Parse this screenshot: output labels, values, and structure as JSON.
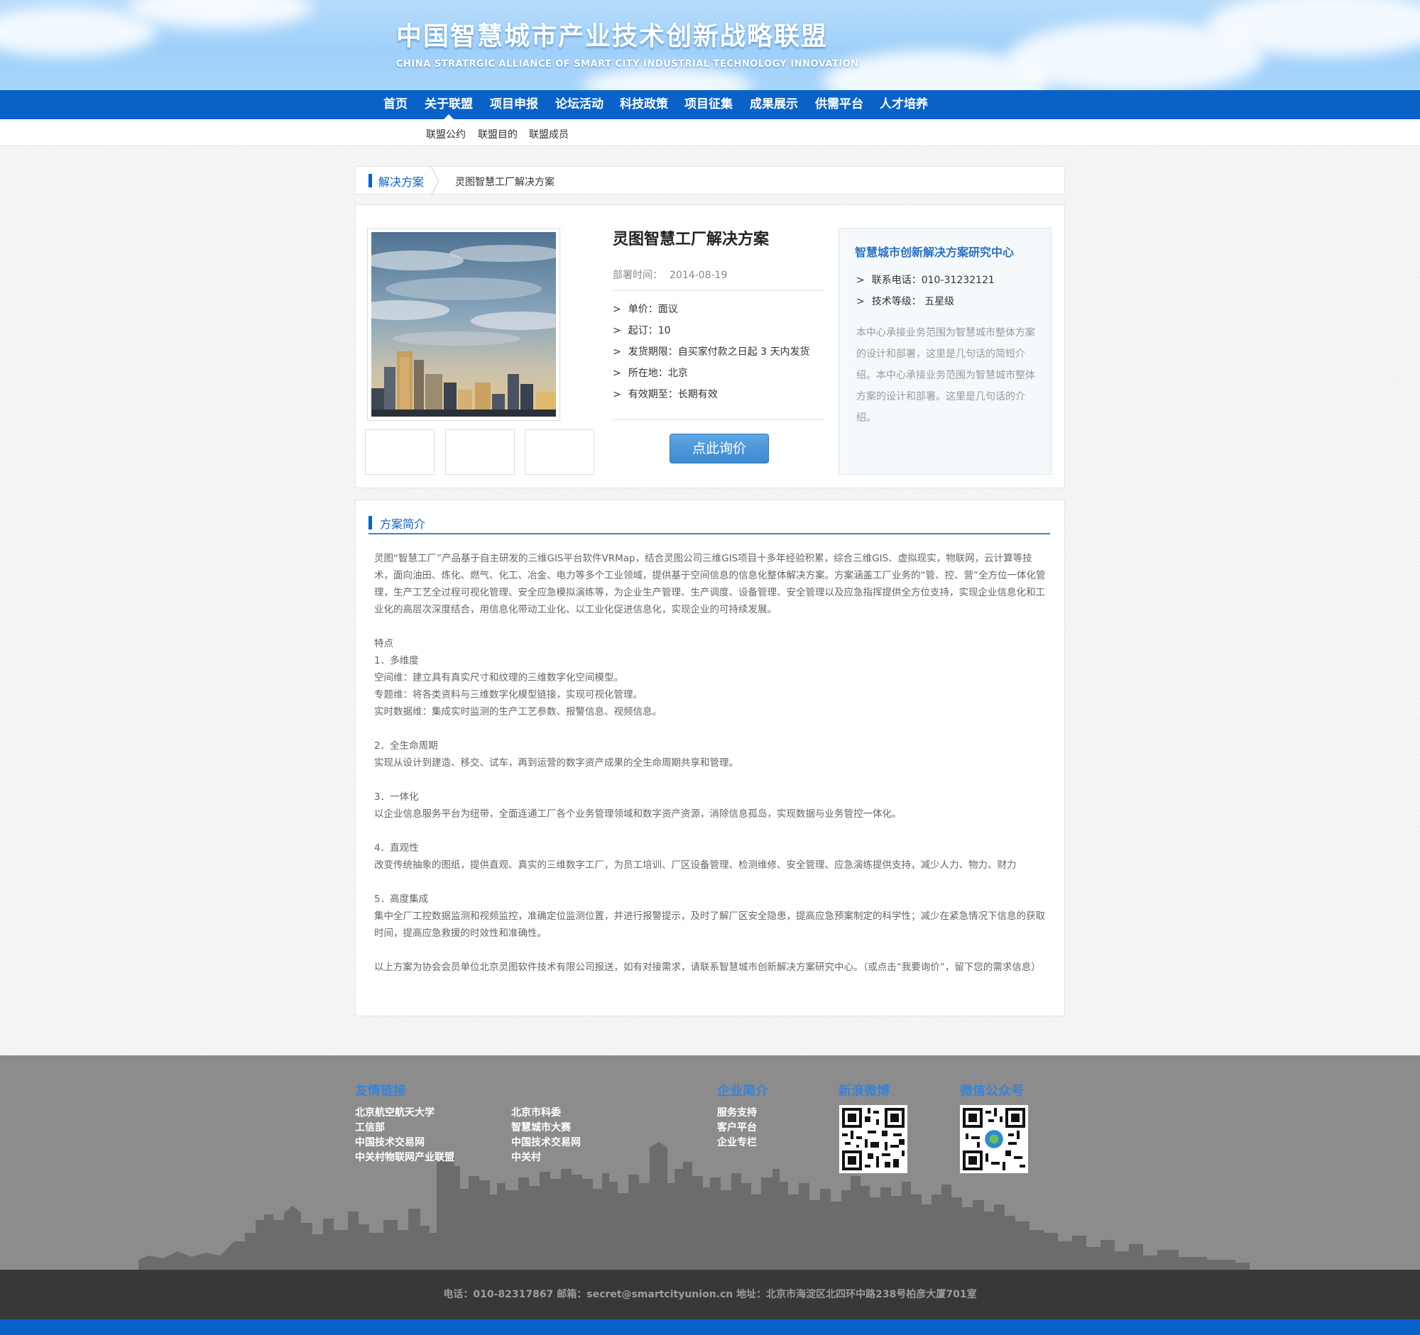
{
  "header": {
    "title": "中国智慧城市产业技术创新战略联盟",
    "subtitle": "CHINA STRATRGIC ALLIANCE OF SMART CITY INDUSTRIAL TECHNOLOGY INNOVATION"
  },
  "nav": {
    "items": [
      "首页",
      "关于联盟",
      "项目申报",
      "论坛活动",
      "科技政策",
      "项目征集",
      "成果展示",
      "供需平台",
      "人才培养"
    ],
    "active": "关于联盟",
    "subitems": [
      "联盟公约",
      "联盟目的",
      "联盟成员"
    ]
  },
  "breadcrumb": {
    "section": "解决方案",
    "current": "灵图智慧工厂解决方案"
  },
  "product": {
    "title": "灵图智慧工厂解决方案",
    "date_label": "部署时间：",
    "date": "2014-08-19",
    "specs": [
      "单价：面议",
      "起订：10",
      "发货期限：自买家付款之日起 3 天内发货",
      "所在地：北京",
      "有效期至：长期有效"
    ],
    "inquiry_button": "点此询价",
    "bullet": ">"
  },
  "center": {
    "title": "智慧城市创新解决方案研究中心",
    "phone": "联系电话：010-31232121",
    "level": "技术等级： 五星级",
    "description": "本中心承接业务范围为智慧城市整体方案的设计和部署，这里是几句话的简短介绍。本中心承接业务范围为智慧城市整体方案的设计和部署。这里是几句话的介绍。"
  },
  "intro": {
    "title": "方案简介",
    "text": "灵图“智慧工厂”产品基于自主研发的三维GIS平台软件VRMap，结合灵图公司三维GIS项目十多年经验积累，综合三维GIS、虚拟现实，物联网，云计算等技术，面向油田、炼化、燃气、化工、冶金、电力等多个工业领域，提供基于空间信息的信息化整体解决方案。方案涵盖工厂业务的“管、控、营”全方位一体化管理，生产工艺全过程可视化管理、安全应急模拟演练等，为企业生产管理、生产调度、设备管理、安全管理以及应急指挥提供全方位支持，实现企业信息化和工业化的高层次深度结合，用信息化带动工业化、以工业化促进信息化，实现企业的可持续发展。\n\n特点\n1．多维度\n空间维：建立具有真实尺寸和纹理的三维数字化空间模型。\n专题维：将各类资料与三维数字化模型链接，实现可视化管理。\n实时数据维：集成实时监测的生产工艺参数、报警信息、视频信息。\n\n2．全生命周期\n实现从设计到建造、移交、试车，再到运营的数字资产成果的全生命周期共享和管理。\n\n3．一体化\n以企业信息服务平台为纽带，全面连通工厂各个业务管理领域和数字资产资源，消除信息孤岛，实现数据与业务管控一体化。\n\n4．直观性\n改变传统抽象的图纸，提供直观、真实的三维数字工厂，为员工培训、厂区设备管理、检测维修、安全管理、应急演练提供支持，减少人力、物力、财力\n\n5．高度集成\n集中全厂工控数据监测和视频监控，准确定位监测位置，并进行报警提示，及时了解厂区安全隐患，提高应急预案制定的科学性；减少在紧急情况下信息的获取时间，提高应急救援的时效性和准确性。\n\n以上方案为协会会员单位北京灵图软件技术有限公司报送，如有对接需求，请联系智慧城市创新解决方案研究中心。（或点击“我要询价”，留下您的需求信息）"
  },
  "footer": {
    "links_title": "友情链接",
    "links_col1": [
      "北京航空航天大学",
      "工信部",
      "中国技术交易网",
      "中关村物联网产业联盟"
    ],
    "links_col2": [
      "北京市科委",
      "智慧城市大赛",
      "中国技术交易网",
      "中关村"
    ],
    "company_title": "企业简介",
    "company_links": [
      "服务支持",
      "客户平台",
      "企业专栏"
    ],
    "weibo_title": "新浪微博",
    "wechat_title": "微信公众号",
    "copyright": "电话：010-82317867 邮箱：secret@smartcityunion.cn 地址：北京市海淀区北四环中路238号柏彦大厦701室"
  },
  "colors": {
    "brand_blue": "#0a62c9",
    "header_sky": "#9fd0fa",
    "footer_gray": "#8c8c8c",
    "footer_dark": "#383838",
    "link_blue": "#2a73c4"
  }
}
